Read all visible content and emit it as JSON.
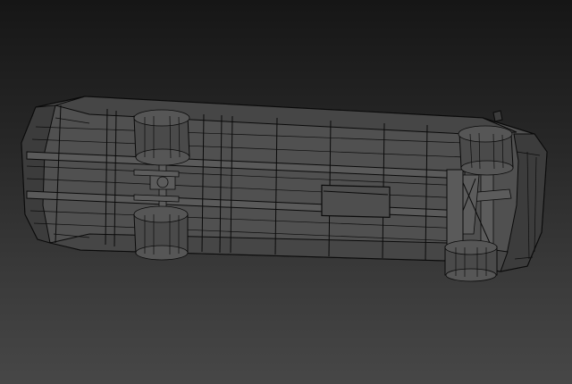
{
  "viewport": {
    "background_top": "#161616",
    "background_bottom": "#474747",
    "wire_color": "#0a0a0a",
    "mesh_color": "#505050"
  }
}
